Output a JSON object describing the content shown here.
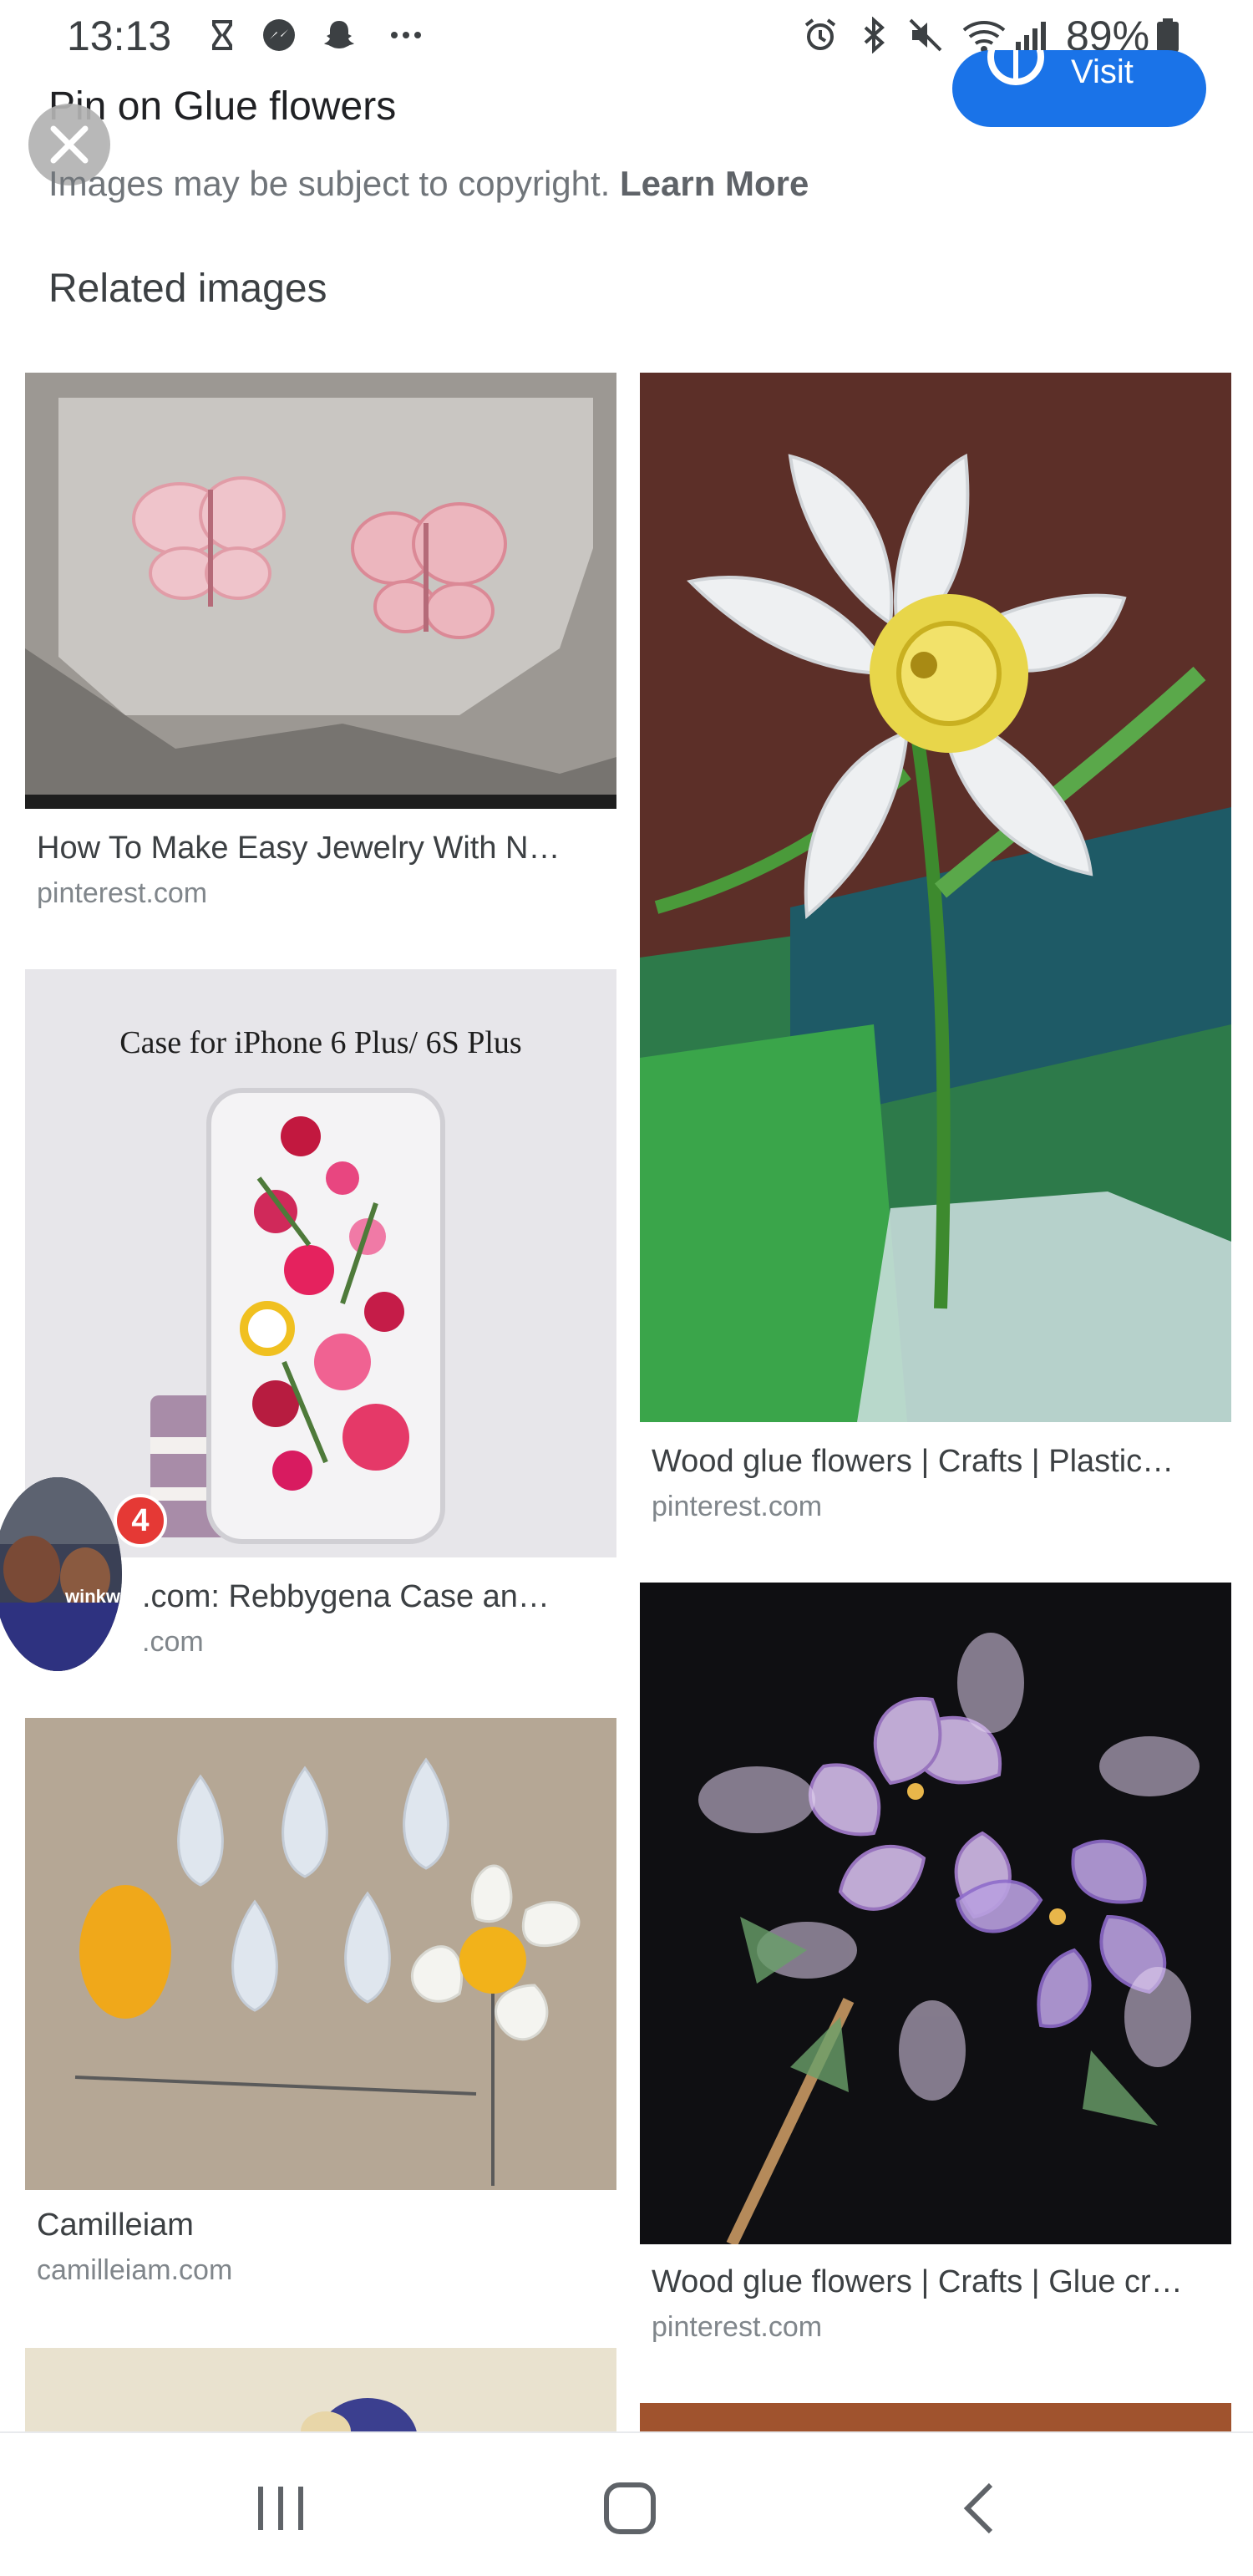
{
  "status_bar": {
    "time": "13:13",
    "battery": "89%",
    "icons": [
      "hourglass-icon",
      "messenger-icon",
      "snapchat-icon",
      "more-icon",
      "alarm-icon",
      "bluetooth-icon",
      "mute-icon",
      "wifi-icon",
      "signal-icon",
      "battery-icon"
    ]
  },
  "header": {
    "title": "Pin on Glue flowers",
    "visit_label": "Visit",
    "copyright_text": "Images may be subject to copyright. ",
    "learn_more": "Learn More",
    "accent": "#1a73e8"
  },
  "related": {
    "heading": "Related images",
    "left_column": [
      {
        "title": "How To Make Easy Jewelry With N…",
        "source": "pinterest.com",
        "image": "butterflies"
      },
      {
        "title": ".com: Rebbygena Case an…",
        "source": ".com",
        "image_text": "Case for iPhone 6 Plus/ 6S Plus",
        "image": "phone-case"
      },
      {
        "title": "Camilleiam",
        "source": "camilleiam.com",
        "image": "felt-petals"
      }
    ],
    "right_column": [
      {
        "title": "Wood glue flowers | Crafts | Plastic…",
        "source": "pinterest.com",
        "image": "daffodil"
      },
      {
        "title": "Wood glue flowers | Crafts | Glue cr…",
        "source": "pinterest.com",
        "image": "lilac-flowers"
      }
    ]
  },
  "chat_head": {
    "name": "winkworth",
    "badge_count": "4"
  },
  "nav": {
    "icons": [
      "recent-apps-icon",
      "home-icon",
      "back-icon"
    ]
  }
}
